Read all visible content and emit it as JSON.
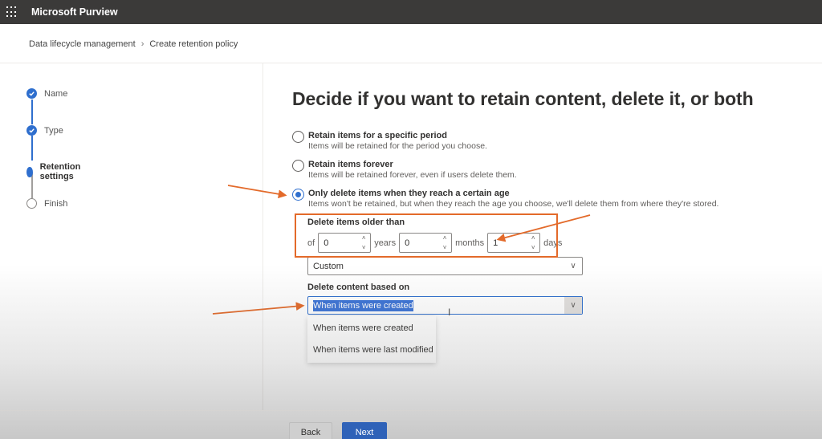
{
  "app": {
    "title": "Microsoft Purview",
    "icon": "waffle-icon"
  },
  "breadcrumb": {
    "items": [
      "Data lifecycle management",
      "Create retention policy"
    ],
    "separator": ">"
  },
  "wizard": {
    "steps": [
      {
        "label": "Name",
        "status": "completed"
      },
      {
        "label": "Type",
        "status": "completed"
      },
      {
        "label": "Retention settings",
        "status": "current"
      },
      {
        "label": "Finish",
        "status": "not-started"
      }
    ]
  },
  "main": {
    "heading": "Decide if you want to retain content, delete it, or both",
    "options": [
      {
        "label": "Retain items for a specific period",
        "description": "Items will be retained for the period you choose.",
        "checked": false
      },
      {
        "label": "Retain items forever",
        "description": "Items will be retained forever, even if users delete them.",
        "checked": false
      },
      {
        "label": "Only delete items when they reach a certain age",
        "description": "Items won't be retained, but when they reach the age you choose, we'll delete them from where they're stored.",
        "checked": true
      }
    ],
    "delete_older": {
      "label": "Delete items older than",
      "prefix": "of",
      "years": {
        "value": "0",
        "unit": "years"
      },
      "months": {
        "value": "0",
        "unit": "months"
      },
      "days": {
        "value": "1",
        "unit": "days"
      }
    },
    "period_dropdown": {
      "value": "Custom"
    },
    "delete_based_on": {
      "label": "Delete content based on",
      "value": "When items were created",
      "options": [
        "When items were created",
        "When items were last modified"
      ]
    }
  },
  "footer": {
    "back_label": "Back",
    "next_label": "Next"
  },
  "annotations": {
    "color": "#e36a2a"
  }
}
